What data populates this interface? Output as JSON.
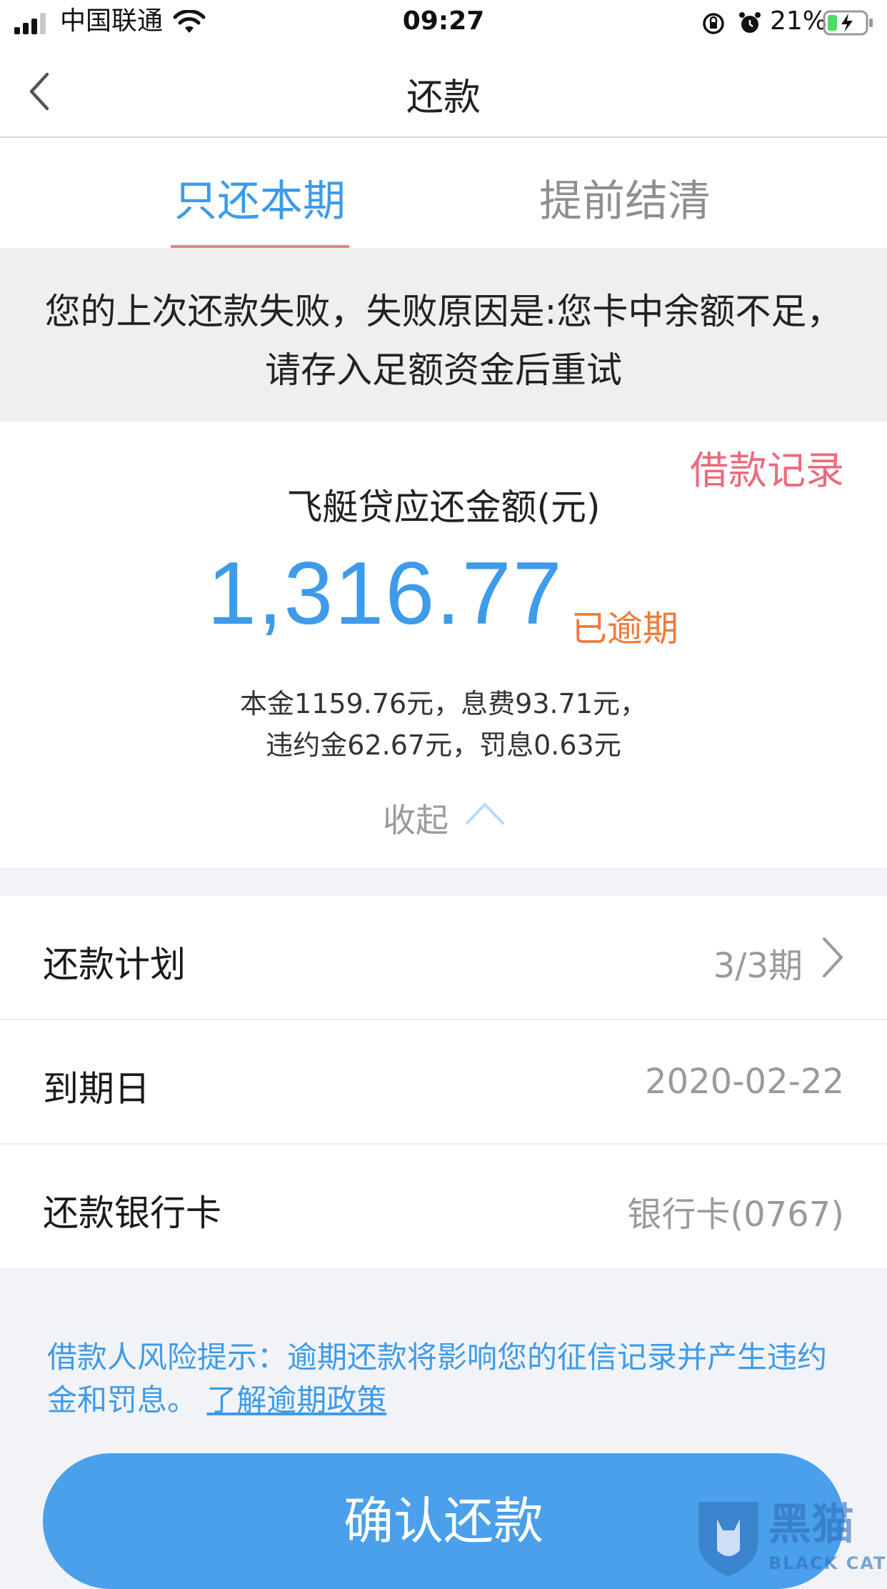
{
  "status_bar": {
    "carrier": "中国联通",
    "time": "09:27",
    "battery_pct": "21%"
  },
  "nav": {
    "title": "还款"
  },
  "tabs": [
    {
      "label": "只还本期",
      "active": true
    },
    {
      "label": "提前结清",
      "active": false
    }
  ],
  "notice": {
    "text": "您的上次还款失败，失败原因是:您卡中余额不足，请存入足额资金后重试"
  },
  "loan": {
    "records_link": "借款记录",
    "amount_label": "飞艇贷应还金额(元)",
    "amount": "1,316.77",
    "status": "已逾期",
    "breakdown_line1": "本金1159.76元，息费93.71元，",
    "breakdown_line2": "违约金62.67元，罚息0.63元",
    "collapse_label": "收起"
  },
  "rows": [
    {
      "label": "还款计划",
      "value": "3/3期"
    },
    {
      "label": "到期日",
      "value": "2020-02-22"
    },
    {
      "label": "还款银行卡",
      "value": "银行卡(0767)"
    }
  ],
  "risk": {
    "text": "借款人风险提示：逾期还款将影响您的征信记录并产生违约金和罚息。",
    "link": "了解逾期政策"
  },
  "confirm_button": "确认还款",
  "watermark": {
    "text_cn": "黑猫",
    "text_en": "BLACK CAT"
  },
  "colors": {
    "accent_blue": "#3d9be9",
    "pink": "#ec6a7e",
    "orange": "#ef7b3a",
    "button_blue": "#4aa0ea"
  }
}
